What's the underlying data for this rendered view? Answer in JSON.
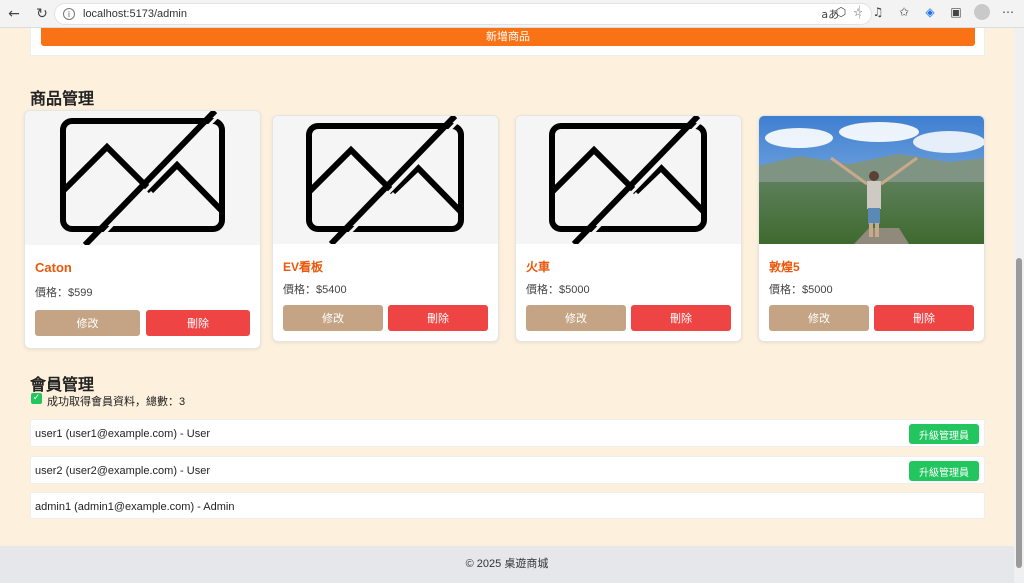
{
  "browser": {
    "url": "localhost:5173/admin",
    "reader_label": "aあ"
  },
  "add_panel": {
    "button_label": "新增商品"
  },
  "products_section": {
    "title": "商品管理"
  },
  "products": [
    {
      "name": "Caton",
      "price": "價格：$599",
      "edit_label": "修改",
      "delete_label": "刪除",
      "image": "broken-image-icon"
    },
    {
      "name": "EV看板",
      "price": "價格：$5400",
      "edit_label": "修改",
      "delete_label": "刪除",
      "image": "broken-image-icon"
    },
    {
      "name": "火車",
      "price": "價格：$5000",
      "edit_label": "修改",
      "delete_label": "刪除",
      "image": "broken-image-icon"
    },
    {
      "name": "敦煌5",
      "price": "價格：$5000",
      "edit_label": "修改",
      "delete_label": "刪除",
      "image": "landscape-photo"
    }
  ],
  "members_section": {
    "title": "會員管理",
    "status_message": "成功取得會員資料，總數：3"
  },
  "members": [
    {
      "text": "user1 (user1@example.com) - User",
      "action_label": "升級管理員"
    },
    {
      "text": "user2 (user2@example.com) - User",
      "action_label": "升級管理員"
    },
    {
      "text": "admin1 (admin1@example.com) - Admin"
    }
  ],
  "footer": {
    "text": "© 2025 桌遊商城"
  },
  "colors": {
    "accent": "#f97316",
    "edit": "#c4a484",
    "delete": "#ef4444",
    "promote": "#22c55e",
    "page_bg": "#fdf0dc"
  }
}
